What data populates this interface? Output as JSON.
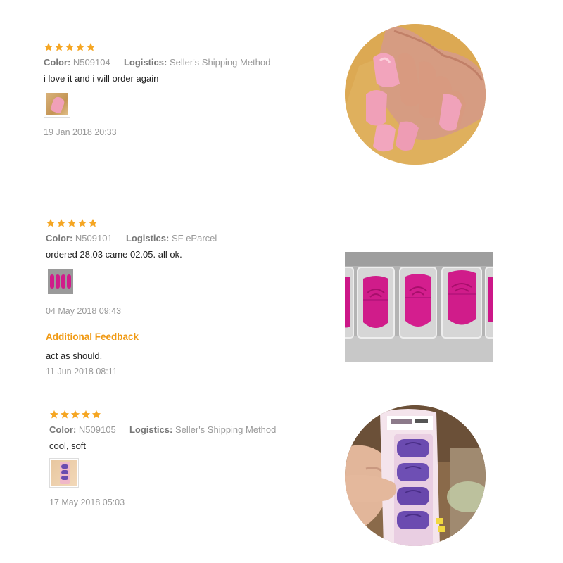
{
  "reviews": [
    {
      "rating": 5,
      "color_label": "Color:",
      "color_value": "N509104",
      "logistics_label": "Logistics:",
      "logistics_value": "Seller's Shipping Method",
      "text": "i love it and i will order again",
      "date": "19 Jan 2018 20:33"
    },
    {
      "rating": 5,
      "color_label": "Color:",
      "color_value": "N509101",
      "logistics_label": "Logistics:",
      "logistics_value": "SF eParcel",
      "text": "ordered 28.03 came 02.05. all ok.",
      "date": "04 May 2018 09:43",
      "additional_title": "Additional Feedback",
      "additional_text": "act as should.",
      "additional_date": "11 Jun 2018 08:11"
    },
    {
      "rating": 5,
      "color_label": "Color:",
      "color_value": "N509105",
      "logistics_label": "Logistics:",
      "logistics_value": "Seller's Shipping Method",
      "text": "cool, soft",
      "date": "17 May 2018 05:03"
    }
  ],
  "colors": {
    "star": "#f5a623",
    "accent": "#f09a14",
    "pink_cap": "#f0a0b8",
    "magenta_cap": "#d01c8a",
    "purple_cap": "#6b4bb0"
  }
}
